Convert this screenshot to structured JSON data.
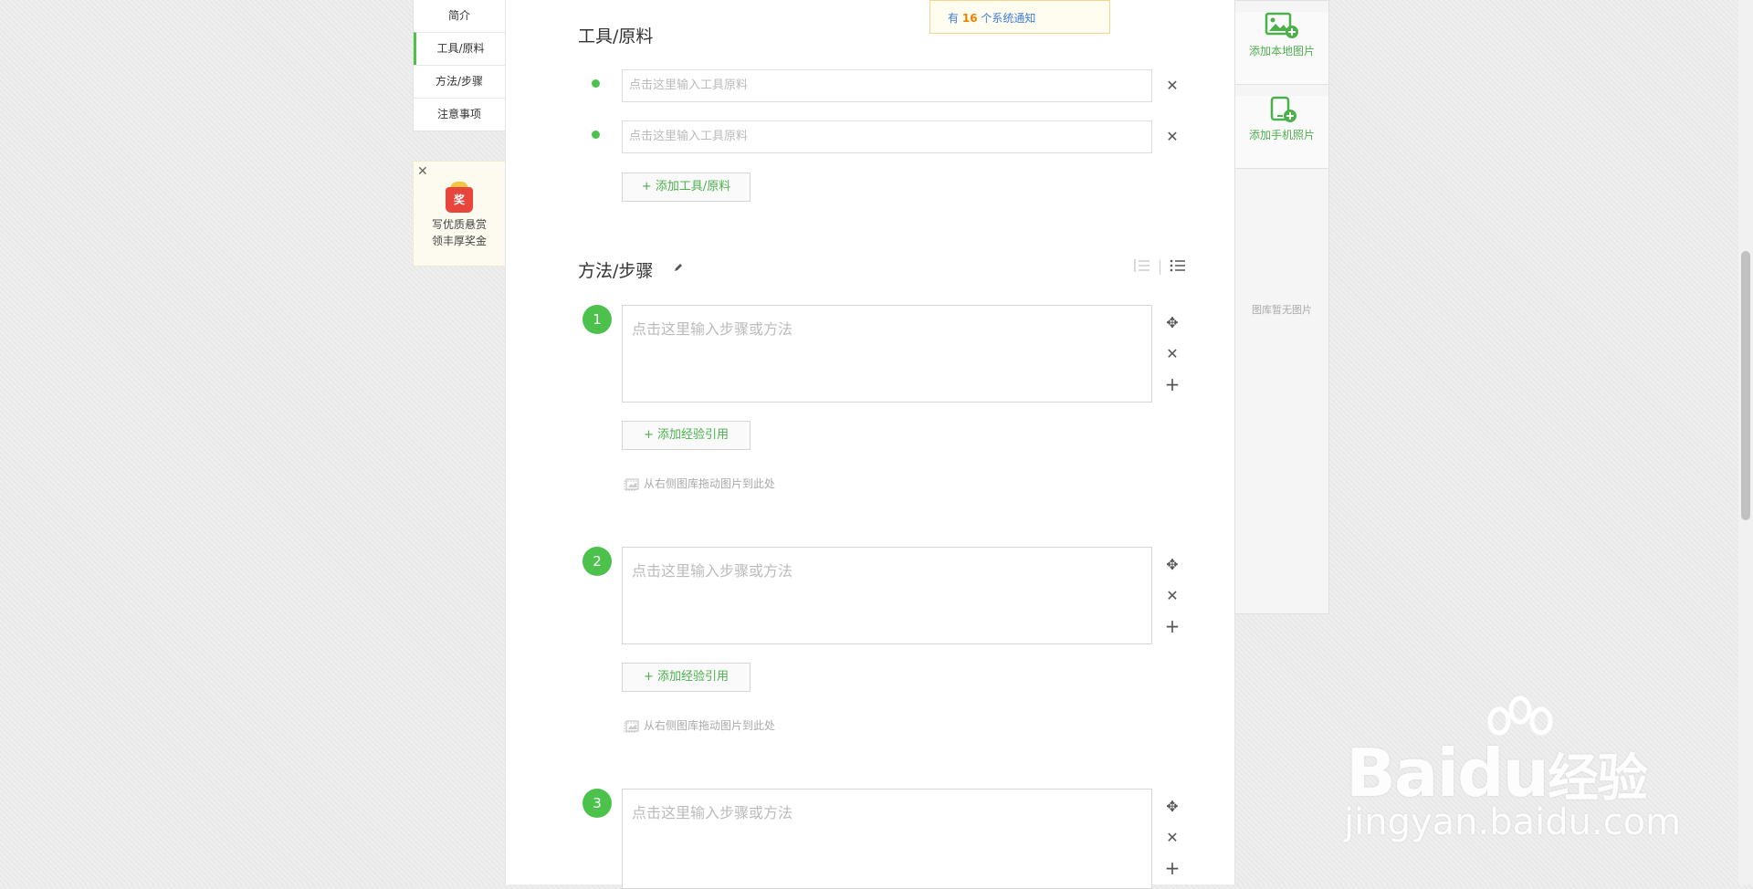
{
  "sidenav": {
    "items": [
      {
        "label": "简介"
      },
      {
        "label": "工具/原料",
        "active": true
      },
      {
        "label": "方法/步骤"
      },
      {
        "label": "注意事项"
      }
    ]
  },
  "promo": {
    "badge": "奖",
    "line1": "写优质悬赏",
    "line2": "领丰厚奖金"
  },
  "notice": {
    "prefix": "有",
    "count": "16",
    "suffix": "个系统通知"
  },
  "tools": {
    "title": "工具/原料",
    "inputs": [
      {
        "placeholder": "点击这里输入工具原料"
      },
      {
        "placeholder": "点击这里输入工具原料"
      }
    ],
    "add_label": "+ 添加工具/原料"
  },
  "steps": {
    "title": "方法/步骤",
    "items": [
      {
        "num": "1",
        "placeholder": "点击这里输入步骤或方法",
        "add_ref": "+ 添加经验引用",
        "drag_hint": "从右侧图库拖动图片到此处"
      },
      {
        "num": "2",
        "placeholder": "点击这里输入步骤或方法",
        "add_ref": "+ 添加经验引用",
        "drag_hint": "从右侧图库拖动图片到此处"
      },
      {
        "num": "3",
        "placeholder": "点击这里输入步骤或方法"
      }
    ]
  },
  "right_panel": {
    "add_local": "添加本地图片",
    "add_phone": "添加手机照片",
    "empty": "图库暂无图片"
  },
  "watermark": {
    "brand_latin": "Baidu",
    "brand_cn": "经验",
    "url": "jingyan.baidu.com"
  },
  "colors": {
    "accent": "#4cc24d",
    "notice_count": "#f08100",
    "notice_text": "#3b7dd8"
  }
}
